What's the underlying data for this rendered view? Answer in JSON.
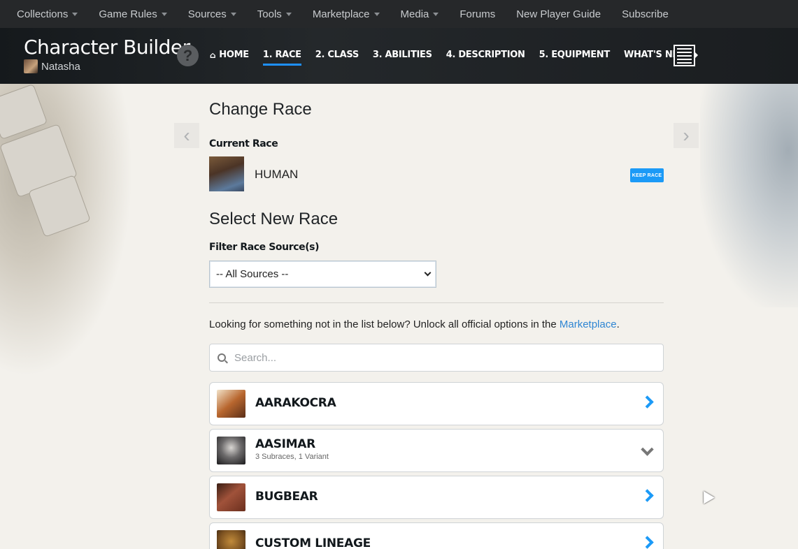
{
  "topnav": {
    "items": [
      {
        "label": "Collections",
        "dropdown": true
      },
      {
        "label": "Game Rules",
        "dropdown": true
      },
      {
        "label": "Sources",
        "dropdown": true
      },
      {
        "label": "Tools",
        "dropdown": true
      },
      {
        "label": "Marketplace",
        "dropdown": true
      },
      {
        "label": "Media",
        "dropdown": true
      },
      {
        "label": "Forums",
        "dropdown": false
      },
      {
        "label": "New Player Guide",
        "dropdown": false
      },
      {
        "label": "Subscribe",
        "dropdown": false
      }
    ]
  },
  "header": {
    "title": "Character Builder",
    "character_name": "Natasha",
    "help_icon": "question-mark",
    "steps": [
      {
        "label": "HOME",
        "icon": "home-icon"
      },
      {
        "label": "1. RACE",
        "active": true
      },
      {
        "label": "2. CLASS"
      },
      {
        "label": "3. ABILITIES"
      },
      {
        "label": "4. DESCRIPTION"
      },
      {
        "label": "5. EQUIPMENT"
      },
      {
        "label": "WHAT'S NEXT"
      }
    ]
  },
  "main": {
    "title": "Change Race",
    "current_race_label": "Current Race",
    "current_race": "HUMAN",
    "keep_button": "KEEP RACE",
    "select_title": "Select New Race",
    "filter_label": "Filter Race Source(s)",
    "filter_value": "-- All Sources --",
    "unlock_text": "Looking for something not in the list below? Unlock all official options in the ",
    "unlock_link": "Marketplace",
    "unlock_end": ".",
    "search_placeholder": "Search...",
    "races": [
      {
        "name": "AARAKOCRA",
        "sub": "",
        "expand": false
      },
      {
        "name": "AASIMAR",
        "sub": "3 Subraces, 1 Variant",
        "expand": true
      },
      {
        "name": "BUGBEAR",
        "sub": "",
        "expand": false
      },
      {
        "name": "CUSTOM LINEAGE",
        "sub": "",
        "expand": false
      }
    ]
  },
  "colors": {
    "accent": "#1b9af7",
    "topnav_bg": "#26282a",
    "link": "#2f86d3"
  }
}
